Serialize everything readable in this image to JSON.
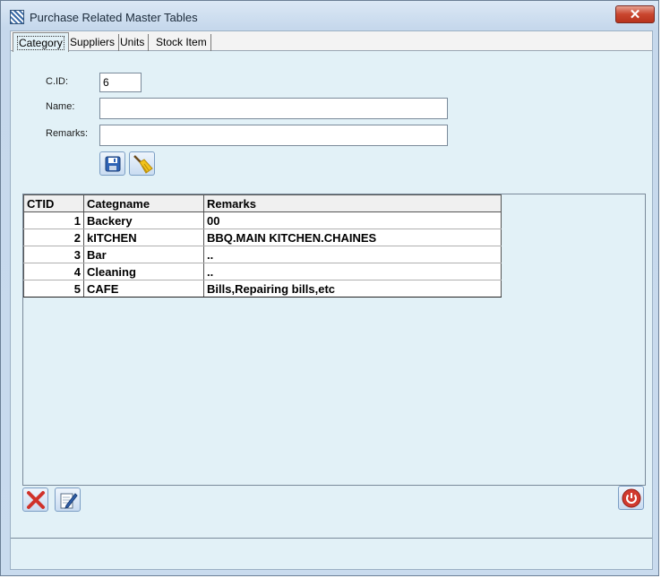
{
  "window": {
    "title": "Purchase Related Master Tables",
    "close_label": "✕"
  },
  "tabs": [
    {
      "label": "Category",
      "active": true
    },
    {
      "label": "Suppliers",
      "active": false
    },
    {
      "label": "Units",
      "active": false
    },
    {
      "label": "Stock Item",
      "active": false
    }
  ],
  "form": {
    "cid_label": "C.ID:",
    "cid_value": "6",
    "name_label": "Name:",
    "name_value": "",
    "remarks_label": "Remarks:",
    "remarks_value": "",
    "save_icon": "floppy-disk-icon",
    "clear_icon": "broom-icon"
  },
  "grid": {
    "columns": [
      "CTID",
      "Categname",
      "Remarks"
    ],
    "rows": [
      {
        "ctid": "1",
        "name": "Backery",
        "remarks": "00"
      },
      {
        "ctid": "2",
        "name": "kITCHEN",
        "remarks": "BBQ.MAIN KITCHEN.CHAINES"
      },
      {
        "ctid": "3",
        "name": "Bar",
        "remarks": ".."
      },
      {
        "ctid": "4",
        "name": "Cleaning",
        "remarks": ".."
      },
      {
        "ctid": "5",
        "name": "CAFE",
        "remarks": "Bills,Repairing bills,etc"
      }
    ]
  },
  "actions": {
    "delete_icon": "red-x-delete-icon",
    "edit_icon": "pencil-edit-icon",
    "power_icon": "power-exit-icon"
  },
  "colors": {
    "client_bg": "#e2f1f7",
    "close_button": "#c9452e",
    "power_button": "#d13a2f"
  }
}
